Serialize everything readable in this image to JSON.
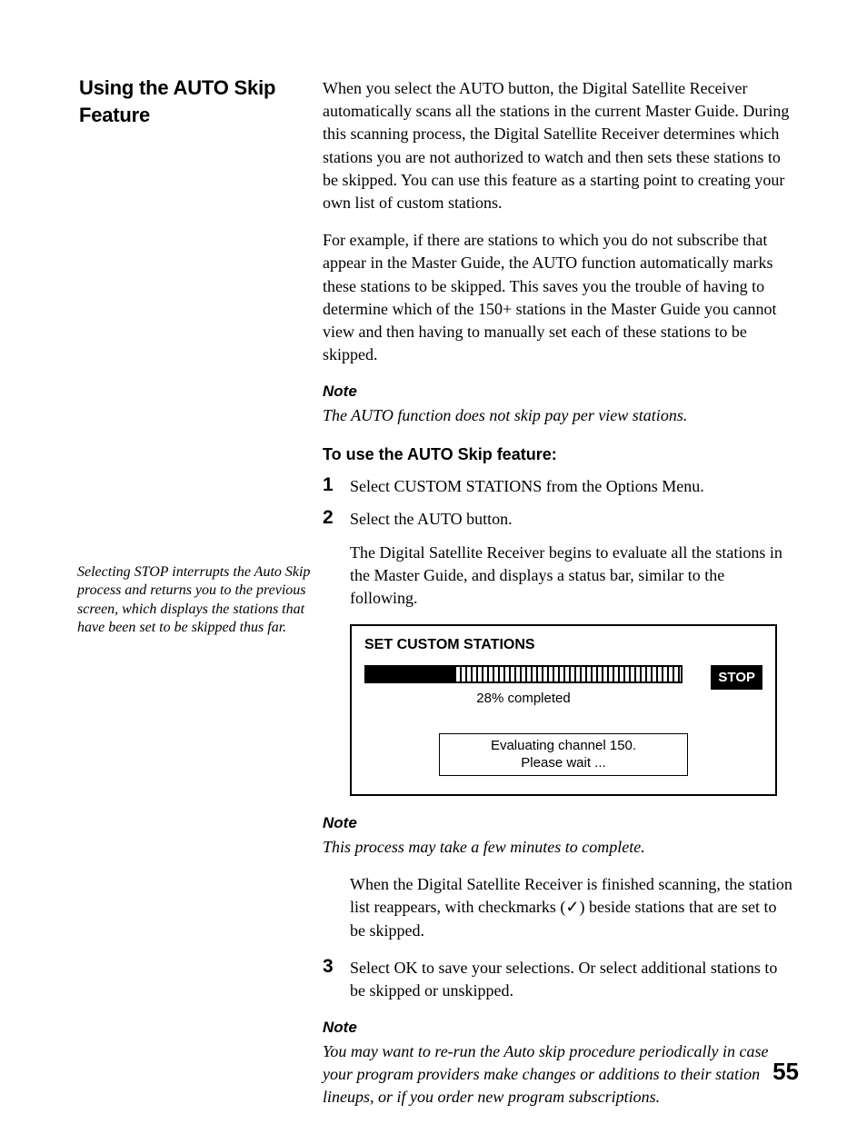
{
  "sidebar": {
    "heading": "Using the AUTO Skip Feature",
    "note": "Selecting STOP interrupts the Auto Skip process and returns you to the previous screen, which displays the stations that have been set to be skipped thus far."
  },
  "body": {
    "p1": "When you select the AUTO button, the Digital Satellite Receiver automatically scans all the stations in the current Master Guide. During this scanning process, the Digital Satellite Receiver determines which stations you are not authorized to watch and then sets these stations to be skipped. You can use this feature as a starting point to creating your own list of custom stations.",
    "p2": "For example, if there are stations to which you do not subscribe that appear in the Master Guide, the AUTO function automatically marks these stations to be skipped. This saves you the trouble of having to determine which of the 150+ stations in the Master Guide you cannot view and then having to manually set each of these stations to be skipped.",
    "note1_label": "Note",
    "note1_text": "The AUTO function does not skip pay per view stations.",
    "subhead1": "To use the AUTO Skip feature:",
    "step1": "Select CUSTOM STATIONS from the Options Menu.",
    "step2a": "Select the AUTO button.",
    "step2b": "The Digital Satellite Receiver begins to evaluate all the stations in the Master Guide, and displays a status bar, similar to the following.",
    "diagram": {
      "title": "SET CUSTOM STATIONS",
      "stop": "STOP",
      "progress_label": "28% completed",
      "status_line1": "Evaluating channel 150.",
      "status_line2": "Please wait ..."
    },
    "note2_label": "Note",
    "note2_text": "This process may take a few minutes to complete.",
    "step2c_a": "When the Digital Satellite Receiver is finished scanning, the station list reappears, with checkmarks (",
    "step2c_check": "✓",
    "step2c_b": ") beside stations that are set to be skipped.",
    "step3": "Select OK to save your selections. Or select additional stations to be skipped or unskipped.",
    "note3_label": "Note",
    "note3_text": "You may want to re-run the Auto skip procedure periodically in case your program providers make changes or additions to their station lineups, or if you order new program subscriptions."
  },
  "page_number": "55"
}
